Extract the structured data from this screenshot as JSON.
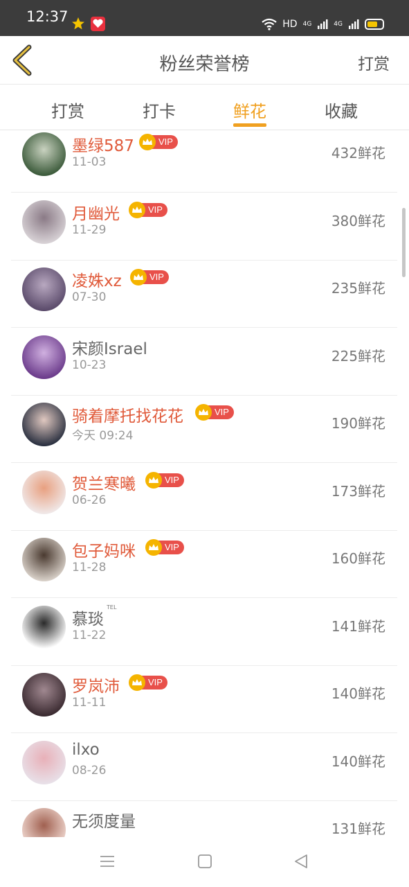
{
  "status_bar": {
    "time": "12:37",
    "network_label": "HD",
    "signal1_label": "4G",
    "signal2_label": "4G",
    "icons": [
      "star-icon",
      "app-badge-icon",
      "wifi-icon",
      "signal-icon",
      "battery-icon"
    ]
  },
  "header": {
    "title": "粉丝荣誉榜",
    "action": "打赏",
    "back_icon": "chevron-left-icon"
  },
  "tabs": [
    {
      "label": "打赏",
      "active": false
    },
    {
      "label": "打卡",
      "active": false
    },
    {
      "label": "鲜花",
      "active": true
    },
    {
      "label": "收藏",
      "active": false
    }
  ],
  "vip_label": "VIP",
  "tel_label": "TEL",
  "fans": [
    {
      "name": "墨绿587",
      "date": "11-03",
      "count": "432鲜花",
      "vip": true
    },
    {
      "name": "月幽光",
      "date": "11-29",
      "count": "380鲜花",
      "vip": true
    },
    {
      "name": "凌姝xz",
      "date": "07-30",
      "count": "235鲜花",
      "vip": true
    },
    {
      "name": "宋颜Israel",
      "date": "10-23",
      "count": "225鲜花",
      "vip": false
    },
    {
      "name": "骑着摩托找花花",
      "date": "今天 09:24",
      "count": "190鲜花",
      "vip": true
    },
    {
      "name": "贺兰寒曦",
      "date": "06-26",
      "count": "173鲜花",
      "vip": true
    },
    {
      "name": "包子妈咪",
      "date": "11-28",
      "count": "160鲜花",
      "vip": true
    },
    {
      "name": "慕琰",
      "date": "11-22",
      "count": "141鲜花",
      "vip": false,
      "tel": true
    },
    {
      "name": "罗岚沛",
      "date": "11-11",
      "count": "140鲜花",
      "vip": true
    },
    {
      "name": "ilxo",
      "date": "08-26",
      "count": "140鲜花",
      "vip": false
    },
    {
      "name": "无须度量",
      "date": "",
      "count": "131鲜花",
      "vip": false
    }
  ],
  "colors": {
    "accent": "#f0a020",
    "vip_name": "#e05a3a",
    "vip_badge": "#e8504a",
    "crown": "#f5b400"
  },
  "nav": {
    "icons": [
      "menu-icon",
      "home-square-icon",
      "back-triangle-icon"
    ]
  }
}
